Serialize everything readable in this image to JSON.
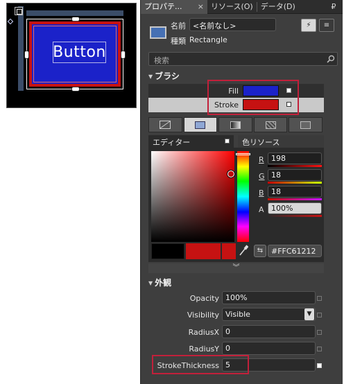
{
  "canvas": {
    "element_text": "Button",
    "fill_color": "#1b22c9",
    "stroke_color": "#c61212"
  },
  "tabs": {
    "properties": "プロパテ...",
    "close": "×",
    "resources": "リソース(O)",
    "data": "データ(D)",
    "pin": "₽"
  },
  "header": {
    "name_label": "名前",
    "name_value": "<名前なし>",
    "type_label": "種類",
    "type_value": "Rectangle",
    "events_glyph": "⚡",
    "props_glyph": "≡"
  },
  "search": {
    "placeholder": "検索",
    "icon": "search-icon"
  },
  "brush": {
    "section_title": "ブラシ",
    "fill_label": "Fill",
    "fill_color": "#1b22c9",
    "stroke_label": "Stroke",
    "stroke_color": "#c61212",
    "highlight_color": "#c2203a",
    "editor_tab": "エディター",
    "resources_tab": "色リソース",
    "types": [
      "no-brush",
      "solid-color",
      "linear-gradient",
      "radial-gradient",
      "tile-brush"
    ]
  },
  "color_editor": {
    "r_label": "R",
    "r_value": "198",
    "g_label": "G",
    "g_value": "18",
    "b_label": "B",
    "b_value": "18",
    "a_label": "A",
    "a_value": "100%",
    "hex_value": "#FFC61212",
    "old_color": "#000000",
    "new_color": "#c61212",
    "expand_glyph": "︾"
  },
  "appearance": {
    "section_title": "外観",
    "opacity_label": "Opacity",
    "opacity_value": "100%",
    "visibility_label": "Visibility",
    "visibility_value": "Visible",
    "radiusx_label": "RadiusX",
    "radiusx_value": "0",
    "radiusy_label": "RadiusY",
    "radiusy_value": "0",
    "strokethickness_label": "StrokeThickness",
    "strokethickness_value": "5"
  }
}
